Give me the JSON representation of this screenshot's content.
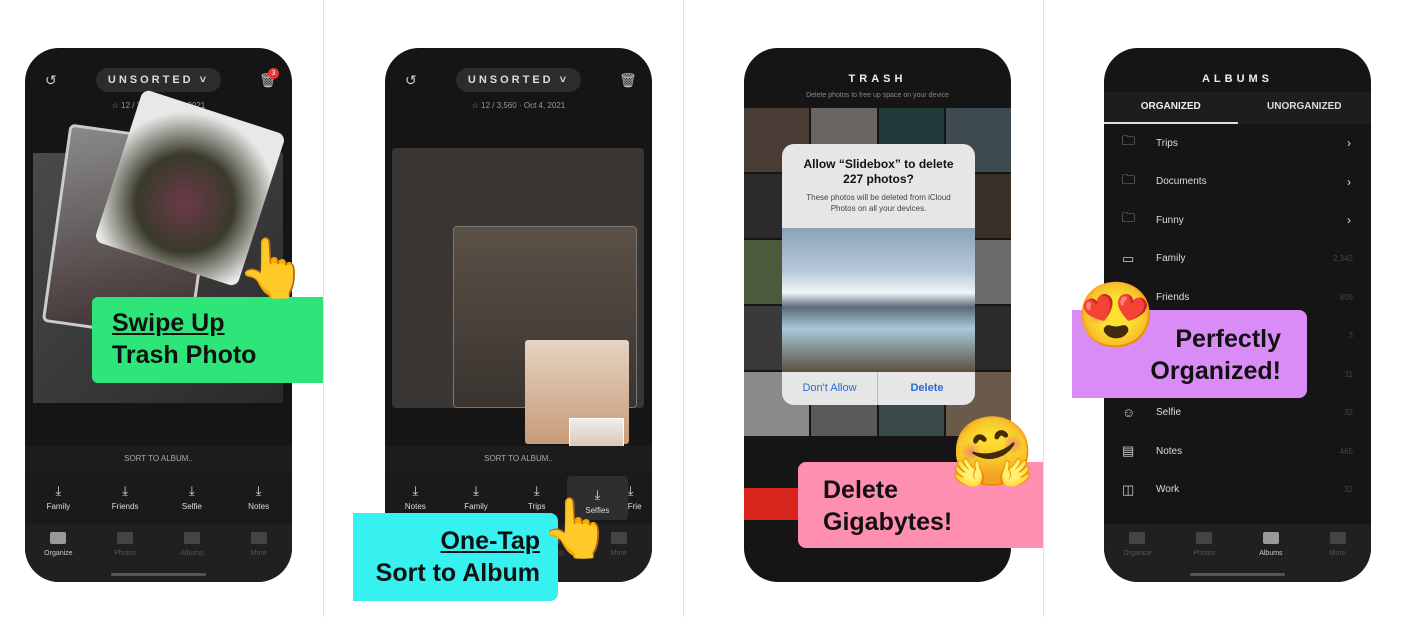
{
  "panel1": {
    "title": "UNSORTED",
    "badge": "3",
    "meta": "☆ 12 / 3,560 · Oct 4, 2021",
    "sort_label": "SORT TO ALBUM..",
    "albums": [
      "Family",
      "Friends",
      "Selfie",
      "Notes"
    ],
    "banner_line1": "Swipe Up",
    "banner_line2": "Trash Photo",
    "banner_color": "#2ee57a"
  },
  "panel2": {
    "title": "UNSORTED",
    "meta": "☆ 12 / 3,560 · Oct 4, 2021",
    "sort_label": "SORT TO ALBUM..",
    "albums": [
      "Notes",
      "Family",
      "Trips",
      "Selfies",
      "Frie"
    ],
    "banner_line1": "One-Tap",
    "banner_line2": "Sort to Album",
    "banner_color": "#37f0f0"
  },
  "panel3": {
    "title": "TRASH",
    "subtitle": "Delete photos to free up space on your device",
    "dialog_title": "Allow “Slidebox” to delete 227 photos?",
    "dialog_body": "These photos will be deleted from iCloud Photos on all your devices.",
    "dont_allow": "Don't Allow",
    "delete": "Delete",
    "banner_line1": "Delete",
    "banner_line2": "Gigabytes!",
    "banner_color": "#ff8fb1"
  },
  "panel4": {
    "title": "ALBUMS",
    "tab_organized": "ORGANIZED",
    "tab_unorganized": "UNORGANIZED",
    "rows": [
      {
        "label": "Trips",
        "icon": "folder-icon",
        "chevron": true
      },
      {
        "label": "Documents",
        "icon": "folder-icon",
        "chevron": true
      },
      {
        "label": "Funny",
        "icon": "folder-icon",
        "chevron": true
      },
      {
        "label": "Family",
        "icon": "album-icon",
        "count": "2,342"
      },
      {
        "label": "Friends",
        "icon": "album-icon",
        "count": "809"
      },
      {
        "label": "",
        "icon": "album-icon",
        "count": "3"
      },
      {
        "label": "",
        "icon": "album-icon",
        "count": "11"
      },
      {
        "label": "Selfie",
        "icon": "smiley-icon",
        "count": "32"
      },
      {
        "label": "Notes",
        "icon": "notes-icon",
        "count": "465"
      },
      {
        "label": "Work",
        "icon": "presentation-icon",
        "count": "32"
      }
    ],
    "banner_line1": "Perfectly",
    "banner_line2": "Organized!",
    "banner_color": "#d98cf5"
  },
  "tabbar": [
    "Organize",
    "Photos",
    "Albums",
    "More"
  ]
}
